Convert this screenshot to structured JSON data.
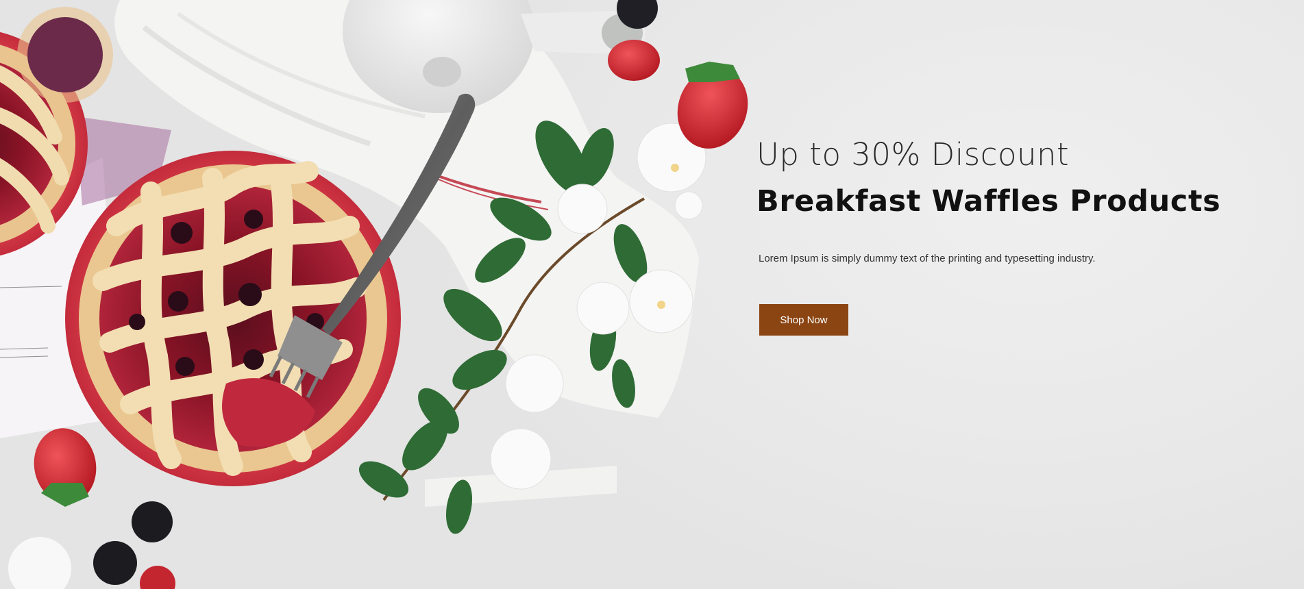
{
  "hero": {
    "subtitle": "Up to 30% Discount",
    "title": "Breakfast Waffles Products",
    "description": "Lorem Ipsum is simply dummy text of the printing and typesetting industry.",
    "cta_label": "Shop Now"
  },
  "colors": {
    "background": "#ebebeb",
    "button": "#8b4513",
    "button_text": "#ffffff",
    "title": "#111111",
    "subtitle": "#2a2a2a",
    "pie_plate": "#d8343f",
    "leaf": "#2f6b35",
    "flower": "#fafafa"
  },
  "images": {
    "hero_art": "berry-pie-breakfast-photo"
  }
}
